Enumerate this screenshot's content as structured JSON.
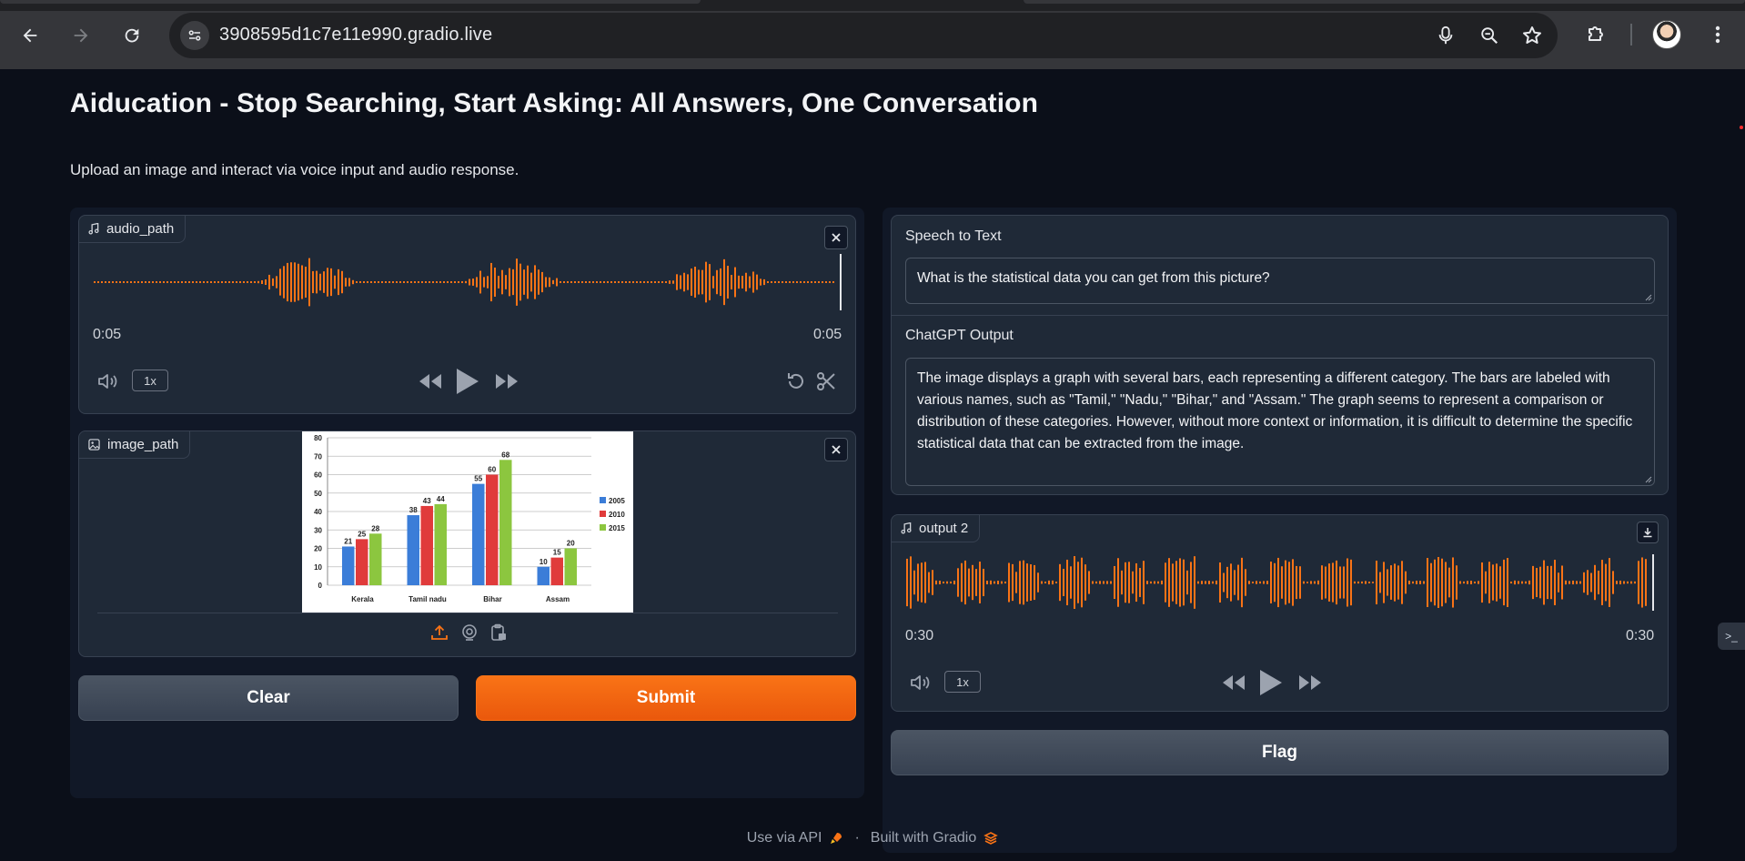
{
  "browser": {
    "url": "3908595d1c7e11e990.gradio.live"
  },
  "app": {
    "title": "Aiducation - Stop Searching, Start Asking: All Answers, One Conversation",
    "description": "Upload an image and interact via voice input and audio response."
  },
  "audio_input": {
    "label": "audio_path",
    "time_current": "0:05",
    "time_total": "0:05",
    "speed": "1x"
  },
  "image_input": {
    "label": "image_path"
  },
  "buttons": {
    "clear": "Clear",
    "submit": "Submit",
    "flag": "Flag"
  },
  "speech_to_text": {
    "label": "Speech to Text",
    "value": "What is the statistical data you can get from this picture?"
  },
  "chatgpt_output": {
    "label": "ChatGPT Output",
    "value": "The image displays a graph with several bars, each representing a different category. The bars are labeled with various names, such as \"Tamil,\" \"Nadu,\" \"Bihar,\" and \"Assam.\" The graph seems to represent a comparison or distribution of these categories. However, without more context or information, it is difficult to determine the specific statistical data that can be extracted from the image."
  },
  "audio_output": {
    "label": "output 2",
    "time_current": "0:30",
    "time_total": "0:30",
    "speed": "1x"
  },
  "footer": {
    "api": "Use via API",
    "separator": "·",
    "built_with": "Built with Gradio"
  },
  "colors": {
    "accent": "#f97316",
    "background": "#0b0f19",
    "block": "#1f2937",
    "series_2005": "#3b7dd8",
    "series_2010": "#e03b3b",
    "series_2015": "#8cc63f"
  },
  "chart_data": {
    "type": "bar",
    "categories": [
      "Kerala",
      "Tamil nadu",
      "Bihar",
      "Assam"
    ],
    "series": [
      {
        "name": "2005",
        "values": [
          21,
          38,
          55,
          10
        ]
      },
      {
        "name": "2010",
        "values": [
          25,
          43,
          60,
          15
        ]
      },
      {
        "name": "2015",
        "values": [
          28,
          44,
          68,
          20
        ]
      }
    ],
    "yticks": [
      "0",
      "10",
      "20",
      "30",
      "40",
      "50",
      "60",
      "70",
      "80"
    ],
    "ylim": [
      0,
      80
    ],
    "grid": true,
    "legend": "right"
  }
}
